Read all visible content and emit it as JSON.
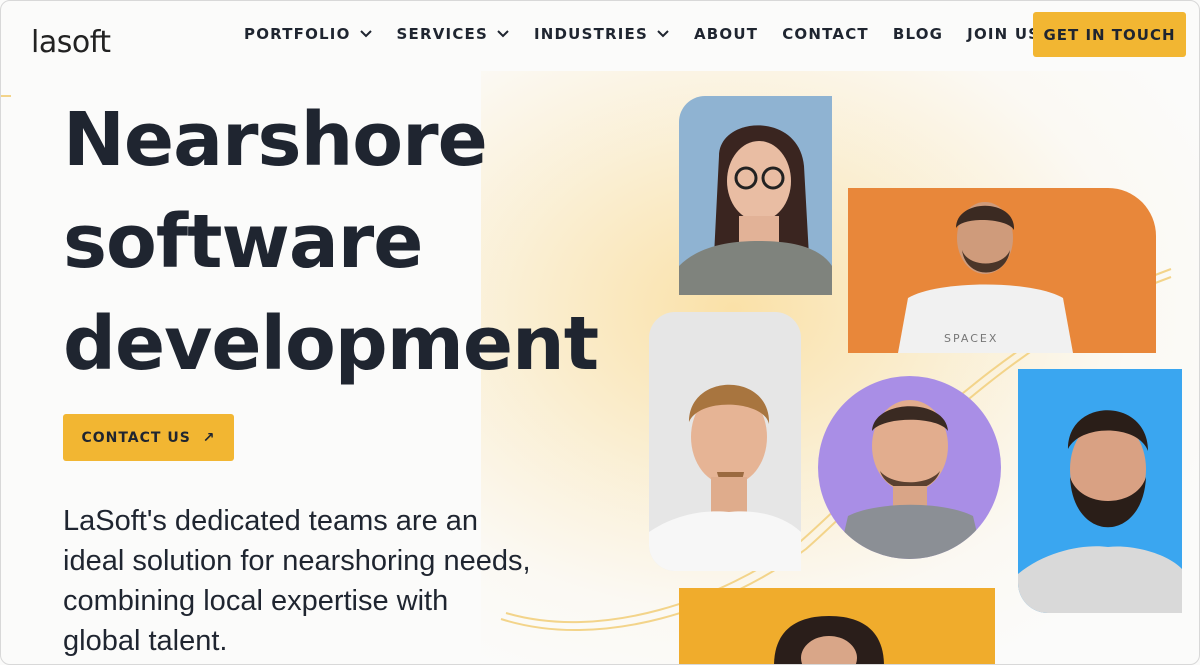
{
  "brand": {
    "logo_text": "lasoft"
  },
  "nav": {
    "items": [
      {
        "label": "PORTFOLIO",
        "has_dropdown": true
      },
      {
        "label": "SERVICES",
        "has_dropdown": true
      },
      {
        "label": "INDUSTRIES",
        "has_dropdown": true
      },
      {
        "label": "ABOUT",
        "has_dropdown": false
      },
      {
        "label": "CONTACT",
        "has_dropdown": false
      },
      {
        "label": "BLOG",
        "has_dropdown": false
      },
      {
        "label": "JOIN US",
        "has_dropdown": false
      }
    ],
    "cta_label": "GET IN TOUCH"
  },
  "hero": {
    "headline_lines": [
      "Nearshore",
      "software",
      "development"
    ],
    "contact_label": "CONTACT US",
    "contact_icon": "arrow-up-right-icon",
    "description_lines": [
      "LaSoft's dedicated teams are an",
      "ideal solution for nearshoring needs,",
      "combining local expertise with",
      "global talent."
    ]
  },
  "team_photos": [
    {
      "name": "photo-woman-glasses",
      "bg": "#8fb0cc"
    },
    {
      "name": "photo-man-spacex",
      "bg": "#e8873a",
      "shirt_text": "SPACEX"
    },
    {
      "name": "photo-man-white-shirt",
      "bg": "#e8e8e8"
    },
    {
      "name": "photo-man-purple",
      "bg": "#a98ee6"
    },
    {
      "name": "photo-man-blue-beard",
      "bg": "#3aa6f0"
    },
    {
      "name": "photo-woman-yellow",
      "bg": "#f0ac2c"
    }
  ],
  "colors": {
    "accent": "#f2b632",
    "text": "#1f2530",
    "background": "#fbfbfa"
  }
}
